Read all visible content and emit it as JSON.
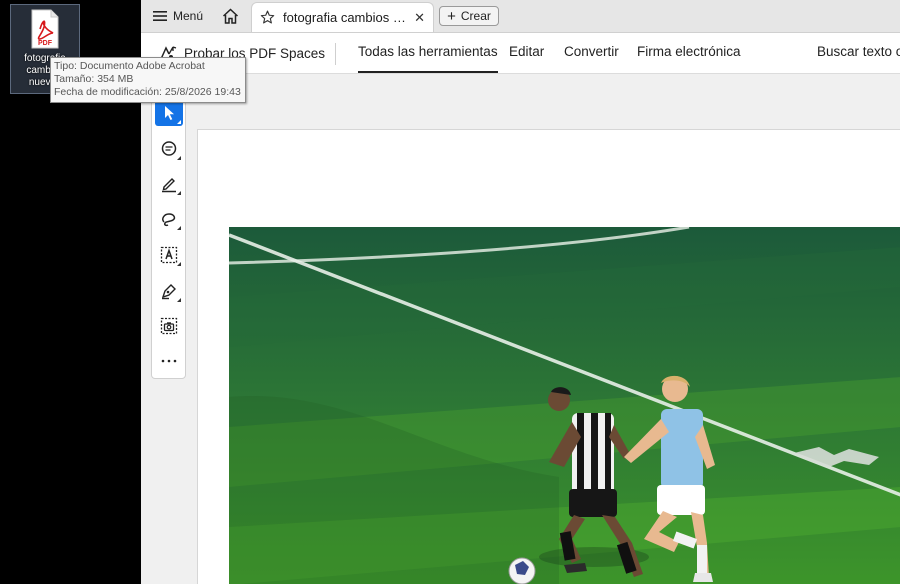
{
  "desktop": {
    "file_label": "fotografia cambios nuevos",
    "file_icon": "pdf-file-icon",
    "pdf_badge": "PDF"
  },
  "tooltip": {
    "type": "Tipo: Documento Adobe Acrobat",
    "size": "Tamaño: 354 MB",
    "modified": "Fecha de modificación: 25/8/2026 19:43"
  },
  "tabbar": {
    "menu_label": "Menú",
    "tab_title": "fotografia cambios n...",
    "create_label": "Crear"
  },
  "toolbar": {
    "spaces_label": "Probar los PDF Spaces",
    "items": [
      "Todas las herramientas",
      "Editar",
      "Convertir",
      "Firma electrónica",
      "Buscar texto o"
    ],
    "active_item": "Todas las herramientas"
  },
  "tools": [
    "select-tool",
    "comment-tool",
    "highlight-tool",
    "draw-tool",
    "text-select-tool",
    "sign-tool",
    "snapshot-tool",
    "more-tools"
  ],
  "colors": {
    "accent": "#1473e6",
    "pitch": "#3f9a2e"
  }
}
